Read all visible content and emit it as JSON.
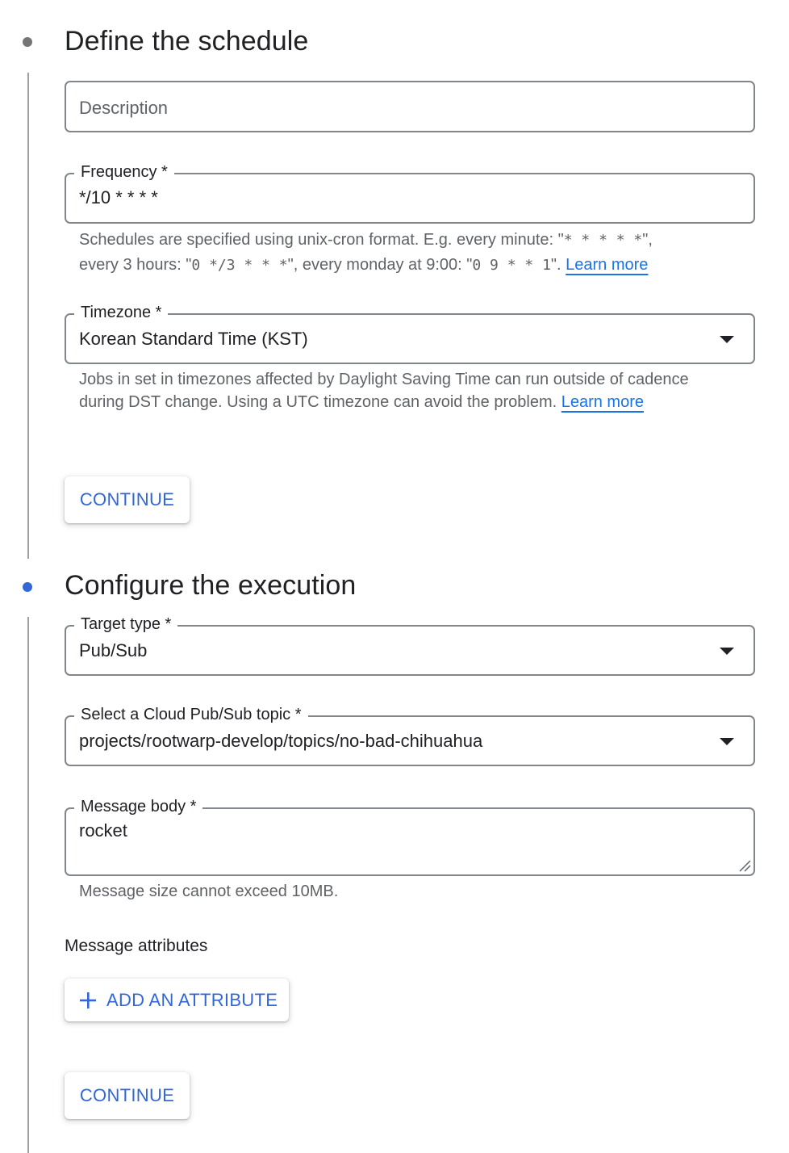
{
  "steps": [
    {
      "title": "Define the schedule",
      "state_color": "#757575"
    },
    {
      "title": "Configure the execution",
      "state_color": "#3367d6"
    }
  ],
  "schedule": {
    "description_placeholder": "Description",
    "frequency_label": "Frequency *",
    "frequency_value": "*/10 * * * *",
    "frequency_hint": {
      "t1": "Schedules are specified using unix-cron format. E.g. every minute: \"",
      "m1": "* * * * *",
      "t2": "\",",
      "t3": "every 3 hours: \"",
      "m2": "0 */3 * * *",
      "t4": "\", every monday at 9:00: \"",
      "m3": "0 9 * * 1",
      "t5": "\". ",
      "link": "Learn more"
    },
    "timezone_label": "Timezone *",
    "timezone_value": "Korean Standard Time (KST)",
    "timezone_hint": {
      "text": "Jobs in set in timezones affected by Daylight Saving Time can run outside of cadence during DST change. Using a UTC timezone can avoid the problem. ",
      "link": "Learn more"
    },
    "continue_label": "CONTINUE"
  },
  "execution": {
    "target_label": "Target type *",
    "target_value": "Pub/Sub",
    "topic_label": "Select a Cloud Pub/Sub topic *",
    "topic_value": "projects/rootwarp-develop/topics/no-bad-chihuahua",
    "body_label": "Message body *",
    "body_value": "rocket",
    "body_hint": "Message size cannot exceed 10MB.",
    "attributes_title": "Message attributes",
    "add_attribute_label": "ADD AN ATTRIBUTE",
    "continue_label": "CONTINUE"
  },
  "icons": {
    "add": "plus-icon",
    "dropdown": "arrow-drop-down-icon",
    "resize": "resize-handle-icon"
  },
  "colors": {
    "accent": "#3367d6",
    "link": "#1a73e8",
    "border": "#80868b",
    "hint": "#5f6368"
  }
}
